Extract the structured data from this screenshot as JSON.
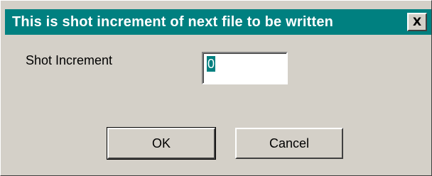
{
  "dialog": {
    "title": "This is shot increment of next file to be written",
    "close_label": "X"
  },
  "form": {
    "label": "Shot Increment",
    "value": "0"
  },
  "buttons": {
    "ok_label": "OK",
    "cancel_label": "Cancel"
  },
  "colors": {
    "titlebar": "#008080",
    "dialog_bg": "#d4d0c8",
    "selection": "#008080"
  }
}
